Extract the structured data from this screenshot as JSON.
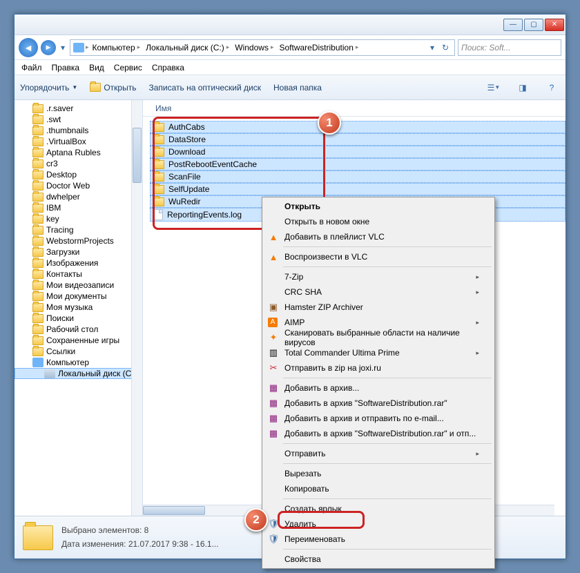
{
  "breadcrumbs": [
    "Компьютер",
    "Локальный диск (C:)",
    "Windows",
    "SoftwareDistribution"
  ],
  "search_placeholder": "Поиск: Soft...",
  "menus": [
    "Файл",
    "Правка",
    "Вид",
    "Сервис",
    "Справка"
  ],
  "toolbar": {
    "organize": "Упорядочить",
    "open": "Открыть",
    "burn": "Записать на оптический диск",
    "newfolder": "Новая папка"
  },
  "list_header": "Имя",
  "tree": {
    "items": [
      {
        "label": ".r.saver",
        "icon": "folder"
      },
      {
        "label": ".swt",
        "icon": "folder"
      },
      {
        "label": ".thumbnails",
        "icon": "folder"
      },
      {
        "label": ".VirtualBox",
        "icon": "folder"
      },
      {
        "label": "Aptana Rubles",
        "icon": "folder"
      },
      {
        "label": "cr3",
        "icon": "folder"
      },
      {
        "label": "Desktop",
        "icon": "folder"
      },
      {
        "label": "Doctor Web",
        "icon": "folder"
      },
      {
        "label": "dwhelper",
        "icon": "folder"
      },
      {
        "label": "IBM",
        "icon": "folder"
      },
      {
        "label": "key",
        "icon": "folder"
      },
      {
        "label": "Tracing",
        "icon": "folder"
      },
      {
        "label": "WebstormProjects",
        "icon": "folder"
      },
      {
        "label": "Загрузки",
        "icon": "folder"
      },
      {
        "label": "Изображения",
        "icon": "folder"
      },
      {
        "label": "Контакты",
        "icon": "folder"
      },
      {
        "label": "Мои видеозаписи",
        "icon": "folder"
      },
      {
        "label": "Мои документы",
        "icon": "folder"
      },
      {
        "label": "Моя музыка",
        "icon": "folder"
      },
      {
        "label": "Поиски",
        "icon": "folder"
      },
      {
        "label": "Рабочий стол",
        "icon": "folder"
      },
      {
        "label": "Сохраненные игры",
        "icon": "folder"
      },
      {
        "label": "Ссылки",
        "icon": "folder"
      },
      {
        "label": "Компьютер",
        "icon": "computer"
      },
      {
        "label": "Локальный диск (C:)",
        "icon": "disk",
        "selected": true,
        "indent": true
      }
    ]
  },
  "files": [
    {
      "name": "AuthCabs",
      "type": "folder",
      "sel": true
    },
    {
      "name": "DataStore",
      "type": "folder",
      "sel": true
    },
    {
      "name": "Download",
      "type": "folder",
      "sel": true
    },
    {
      "name": "PostRebootEventCache",
      "type": "folder",
      "sel": true
    },
    {
      "name": "ScanFile",
      "type": "folder",
      "sel": true
    },
    {
      "name": "SelfUpdate",
      "type": "folder",
      "sel": true
    },
    {
      "name": "WuRedir",
      "type": "folder",
      "sel": true
    },
    {
      "name": "ReportingEvents.log",
      "type": "doc",
      "sel": true
    }
  ],
  "context": {
    "open": "Открыть",
    "open_new": "Открыть в новом окне",
    "vlc_add": "Добавить в плейлист VLC",
    "vlc_play": "Воспроизвести в VLC",
    "sevenzip": "7-Zip",
    "crcsha": "CRC SHA",
    "hamster": "Hamster ZIP Archiver",
    "aimp": "AIMP",
    "scan": "Сканировать выбранные области на наличие вирусов",
    "tcup": "Total Commander Ultima Prime",
    "joxi": "Отправить в zip на joxi.ru",
    "rar_add": "Добавить в архив...",
    "rar_name": "Добавить в архив \"SoftwareDistribution.rar\"",
    "rar_email": "Добавить в архив и отправить по e-mail...",
    "rar_name_email": "Добавить в архив \"SoftwareDistribution.rar\" и отп...",
    "sendto": "Отправить",
    "cut": "Вырезать",
    "copy": "Копировать",
    "shortcut": "Создать ярлык",
    "delete": "Удалить",
    "rename": "Переименовать",
    "props": "Свойства"
  },
  "status": {
    "selected": "Выбрано элементов: 8",
    "modified": "Дата изменения: 21.07.2017 9:38 - 16.1..."
  },
  "callouts": {
    "one": "1",
    "two": "2"
  }
}
